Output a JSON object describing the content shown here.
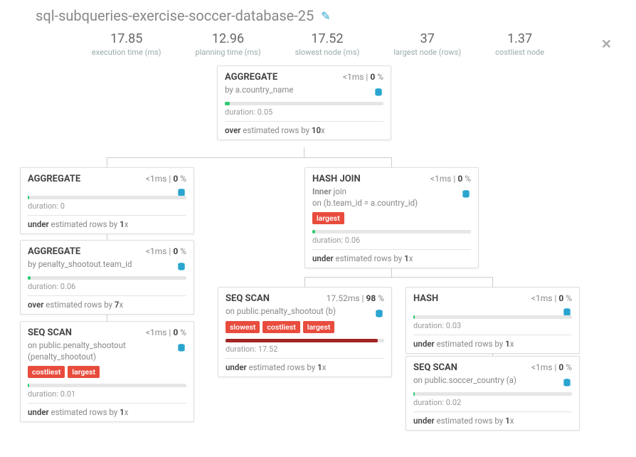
{
  "page": {
    "title": "sql-subqueries-exercise-soccer-database-25"
  },
  "stats": {
    "exec_val": "17.85",
    "exec_label": "execution time (ms)",
    "plan_val": "12.96",
    "plan_label": "planning time (ms)",
    "slowest_val": "17.52",
    "slowest_label": "slowest node (ms)",
    "largest_val": "37",
    "largest_label": "largest node (rows)",
    "cost_val": "1.37",
    "cost_label": "costliest node"
  },
  "labels": {
    "ms": "ms",
    "pct": "%",
    "duration_prefix": "duration: "
  },
  "tag_text": {
    "slowest": "slowest",
    "costliest": "costliest",
    "largest": "largest"
  },
  "nodes": {
    "root": {
      "title": "AGGREGATE",
      "time_lt": "<1",
      "pct": "0",
      "sub_prefix": "by ",
      "sub_val": "a.country_name",
      "dur": "0.05",
      "est_prefix": "over",
      "est_mid": " estimated rows by ",
      "est_fac": "10",
      "est_suf": "x",
      "bar_pct": 3
    },
    "agg2": {
      "title": "AGGREGATE",
      "time_lt": "<1",
      "pct": "0",
      "dur": "0",
      "est_prefix": "under",
      "est_mid": " estimated rows by ",
      "est_fac": "1",
      "est_suf": "x",
      "bar_pct": 1
    },
    "agg3": {
      "title": "AGGREGATE",
      "time_lt": "<1",
      "pct": "0",
      "sub_prefix": "by ",
      "sub_val": "penalty_shootout.team_id",
      "dur": "0.06",
      "est_prefix": "over",
      "est_mid": " estimated rows by ",
      "est_fac": "7",
      "est_suf": "x",
      "bar_pct": 2
    },
    "scan1": {
      "title": "SEQ SCAN",
      "time_lt": "<1",
      "pct": "0",
      "sub_prefix": "on ",
      "sub_val": "public.penalty_shootout (penalty_shootout)",
      "dur": "0.01",
      "est_prefix": "under",
      "est_mid": " estimated rows by ",
      "est_fac": "1",
      "est_suf": "x",
      "bar_pct": 1
    },
    "hashjoin": {
      "title": "HASH JOIN",
      "time_lt": "<1",
      "pct": "0",
      "join_prefix": "Inner",
      "join_word": " join",
      "join_on": "on (b.team_id = a.country_id)",
      "dur": "0.06",
      "est_prefix": "under",
      "est_mid": " estimated rows by ",
      "est_fac": "1",
      "est_suf": "x",
      "bar_pct": 2
    },
    "scan2": {
      "title": "SEQ SCAN",
      "time_val": "17.52",
      "pct": "98",
      "sub_prefix": "on ",
      "sub_val": "public.penalty_shootout (b)",
      "dur": "17.52",
      "est_prefix": "under",
      "est_mid": " estimated rows by ",
      "est_fac": "1",
      "est_suf": "x",
      "bar_pct": 96
    },
    "hash": {
      "title": "HASH",
      "time_lt": "<1",
      "pct": "0",
      "dur": "0.03",
      "est_prefix": "under",
      "est_mid": " estimated rows by ",
      "est_fac": "1",
      "est_suf": "x",
      "bar_pct": 1
    },
    "scan3": {
      "title": "SEQ SCAN",
      "time_lt": "<1",
      "pct": "0",
      "sub_prefix": "on ",
      "sub_val": "public.soccer_country (a)",
      "dur": "0.02",
      "est_prefix": "under",
      "est_mid": " estimated rows by ",
      "est_fac": "1",
      "est_suf": "x",
      "bar_pct": 1
    }
  }
}
